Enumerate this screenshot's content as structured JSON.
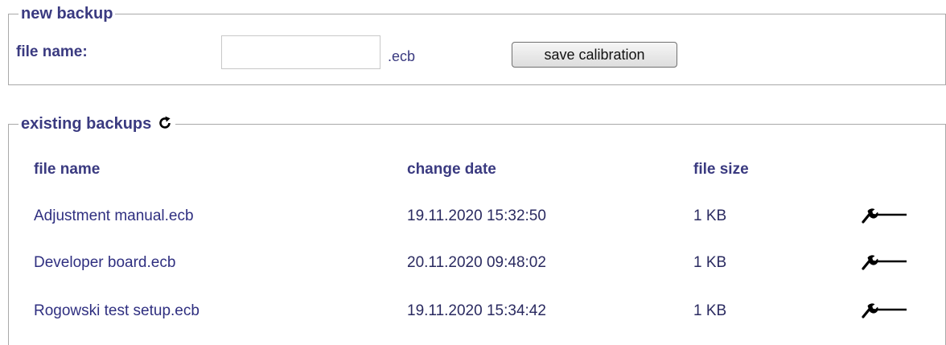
{
  "new_backup": {
    "legend": "new backup",
    "file_name_label": "file name:",
    "file_name_value": "",
    "extension": ".ecb",
    "save_label": "save calibration"
  },
  "existing_backups": {
    "legend": "existing backups",
    "refresh_icon": "refresh-icon",
    "columns": {
      "name": "file name",
      "date": "change date",
      "size": "file size"
    },
    "rows": [
      {
        "name": "Adjustment manual.ecb",
        "date": "19.11.2020 15:32:50",
        "size": "1 KB",
        "action_icon": "wrench-icon"
      },
      {
        "name": "Developer board.ecb",
        "date": "20.11.2020 09:48:02",
        "size": "1 KB",
        "action_icon": "wrench-icon"
      },
      {
        "name": "Rogowski test setup.ecb",
        "date": "19.11.2020 15:34:42",
        "size": "1 KB",
        "action_icon": "wrench-icon"
      }
    ]
  }
}
